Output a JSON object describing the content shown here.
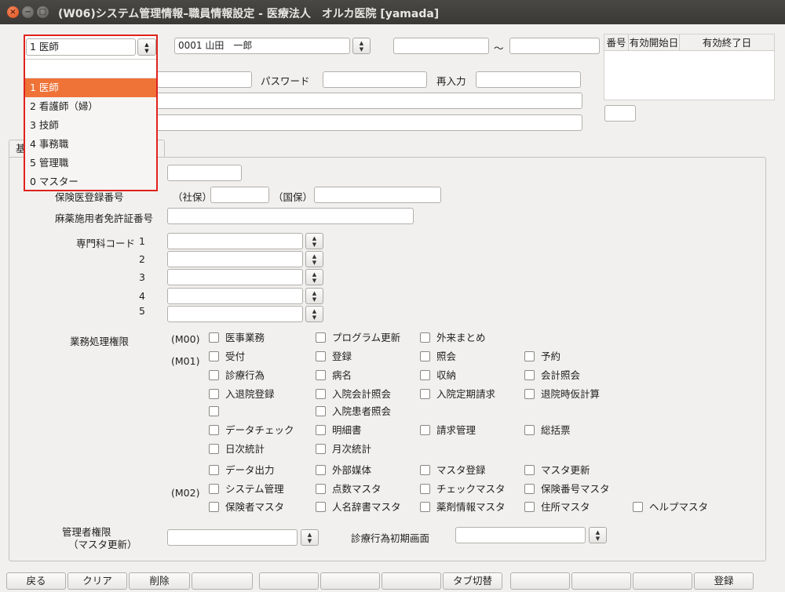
{
  "window": {
    "title": "(W06)システム管理情報–職員情報設定 - 医療法人　オルカ医院  [yamada]"
  },
  "header": {
    "job_select_value": "1 医師",
    "user_select_value": "0001 山田　一郎",
    "range_separator": "～",
    "range_from": "",
    "range_to": ""
  },
  "validity_table": {
    "columns": [
      "番号",
      "有効開始日",
      "有効終了日"
    ],
    "rows": []
  },
  "login": {
    "password_label": "パスワード",
    "password_value": "",
    "confirm_label": "再入力",
    "confirm_value": "",
    "user_value": "",
    "name_value": "",
    "kana_value": "",
    "small_value": ""
  },
  "tabs": [
    "基",
    ""
  ],
  "form": {
    "insurance_label": "保険医登録番号",
    "shaho_label": "（社保）",
    "kokuho_label": "（国保）",
    "narcotic_label": "麻薬施用者免許証番号",
    "specialty_label": "専門科コード",
    "specialty_rows": [
      "1",
      "2",
      "3",
      "4",
      "5"
    ],
    "permissions_label": "業務処理権限",
    "m00_label": "(M00)",
    "m01_label": "(M01)",
    "m02_label": "(M02)",
    "m00": [
      "医事業務",
      "プログラム更新",
      "外来まとめ"
    ],
    "m01_row1": [
      "受付",
      "登録",
      "照会",
      "予約"
    ],
    "m01_row2": [
      "診療行為",
      "病名",
      "収納",
      "会計照会"
    ],
    "m01_row3": [
      "入退院登録",
      "入院会計照会",
      "入院定期請求",
      "退院時仮計算"
    ],
    "m01_row4": [
      "",
      "入院患者照会"
    ],
    "m01_row5": [
      "データチェック",
      "明細書",
      "請求管理",
      "総括票"
    ],
    "m01_row6": [
      "日次統計",
      "月次統計"
    ],
    "m01_row7": [
      "データ出力",
      "外部媒体",
      "マスタ登録",
      "マスタ更新"
    ],
    "m02_row1": [
      "システム管理",
      "点数マスタ",
      "チェックマスタ",
      "保険番号マスタ"
    ],
    "m02_row2": [
      "保険者マスタ",
      "人名辞書マスタ",
      "薬剤情報マスタ",
      "住所マスタ",
      "ヘルプマスタ"
    ],
    "admin_label_1": "管理者権限",
    "admin_label_2": "（マスタ更新）",
    "initial_screen_label": "診療行為初期画面"
  },
  "dropdown": {
    "options": [
      "1 医師",
      "2 看護師（婦）",
      "3 技師",
      "4 事務職",
      "5 管理職",
      "0 マスター"
    ],
    "selected_index": 0
  },
  "footer": {
    "buttons": [
      "戻る",
      "クリア",
      "削除",
      "",
      "",
      "",
      "",
      "タブ切替",
      "",
      "",
      "",
      "登録"
    ]
  },
  "colors": {
    "highlight": "#ef7236",
    "dropdown_outline": "#e0221c",
    "titlebar": "#3c3b37"
  }
}
